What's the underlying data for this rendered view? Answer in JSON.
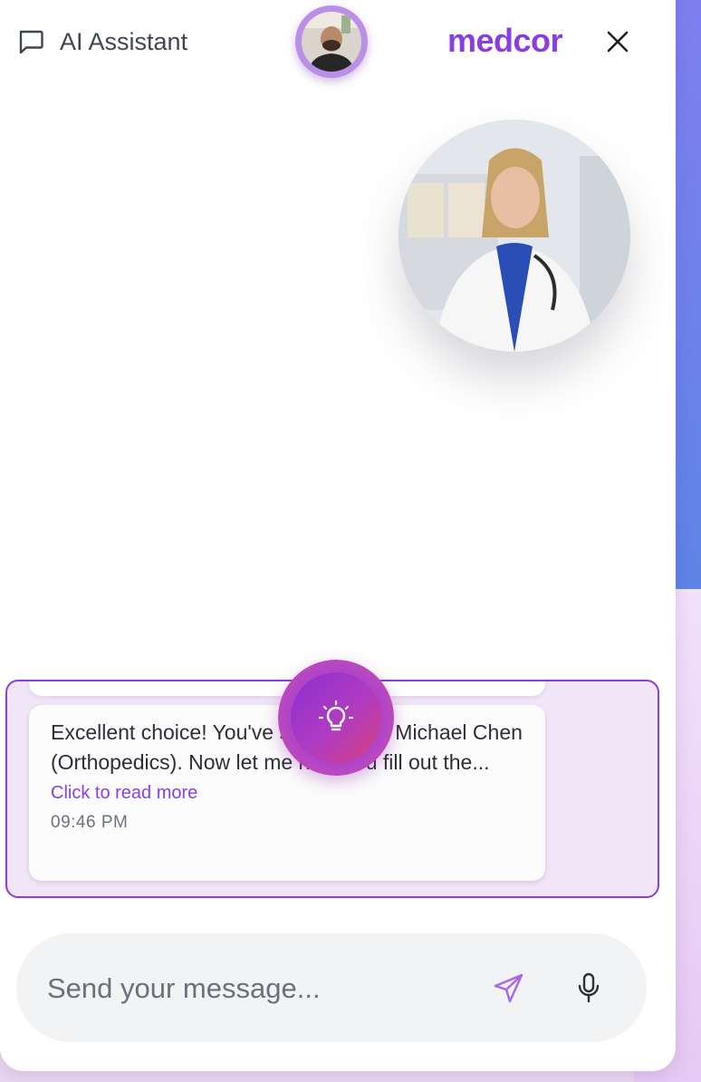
{
  "header": {
    "title": "AI Assistant",
    "brand": "medcor",
    "title_icon": "chat-bubble-icon",
    "close_icon": "close-icon"
  },
  "assistant": {
    "avatar": "doctor-portrait"
  },
  "user": {
    "avatar": "user-avatar"
  },
  "chat": {
    "messages": [
      {
        "text": "Excellent choice! You've selected Dr. Michael Chen (Orthopedics). Now let me help you fill out the...",
        "read_more": "Click to read more",
        "time": "09:46 PM"
      }
    ]
  },
  "floating_button": {
    "icon": "lightbulb-icon"
  },
  "composer": {
    "placeholder": "Send your message...",
    "send_icon": "send-icon",
    "mic_icon": "microphone-icon"
  },
  "colors": {
    "accent": "#8a3ee0",
    "chat_bg": "#f1e5f8",
    "input_bg": "#f2f3f5"
  }
}
